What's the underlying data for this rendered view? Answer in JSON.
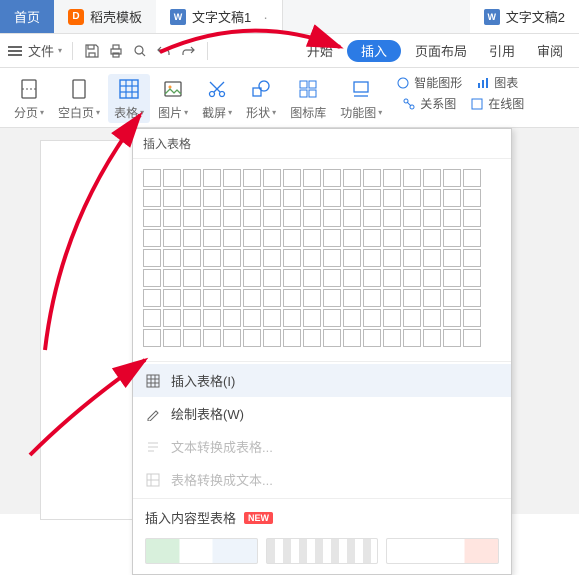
{
  "tabs": {
    "home": "首页",
    "dk": "稻壳模板",
    "doc1": "文字文稿1",
    "doc2": "文字文稿2"
  },
  "menubar": {
    "file": "文件",
    "start": "开始",
    "insert": "插入",
    "pagelayout": "页面布局",
    "reference": "引用",
    "review": "审阅"
  },
  "toolbar": {
    "page_break": "分页",
    "blank_page": "空白页",
    "table": "表格",
    "picture": "图片",
    "screenshot": "截屏",
    "shapes": "形状",
    "icon_lib": "图标库",
    "feature": "功能图",
    "smart_shape": "智能图形",
    "chart": "图表",
    "relation": "关系图",
    "online_pic": "在线图"
  },
  "dropdown": {
    "title": "插入表格",
    "insert_table": "插入表格(I)",
    "draw_table": "绘制表格(W)",
    "text_to_table": "文本转换成表格...",
    "table_to_text": "表格转换成文本...",
    "content_title": "插入内容型表格",
    "new_badge": "NEW",
    "grid": {
      "cols": 17,
      "rows": 9
    }
  }
}
